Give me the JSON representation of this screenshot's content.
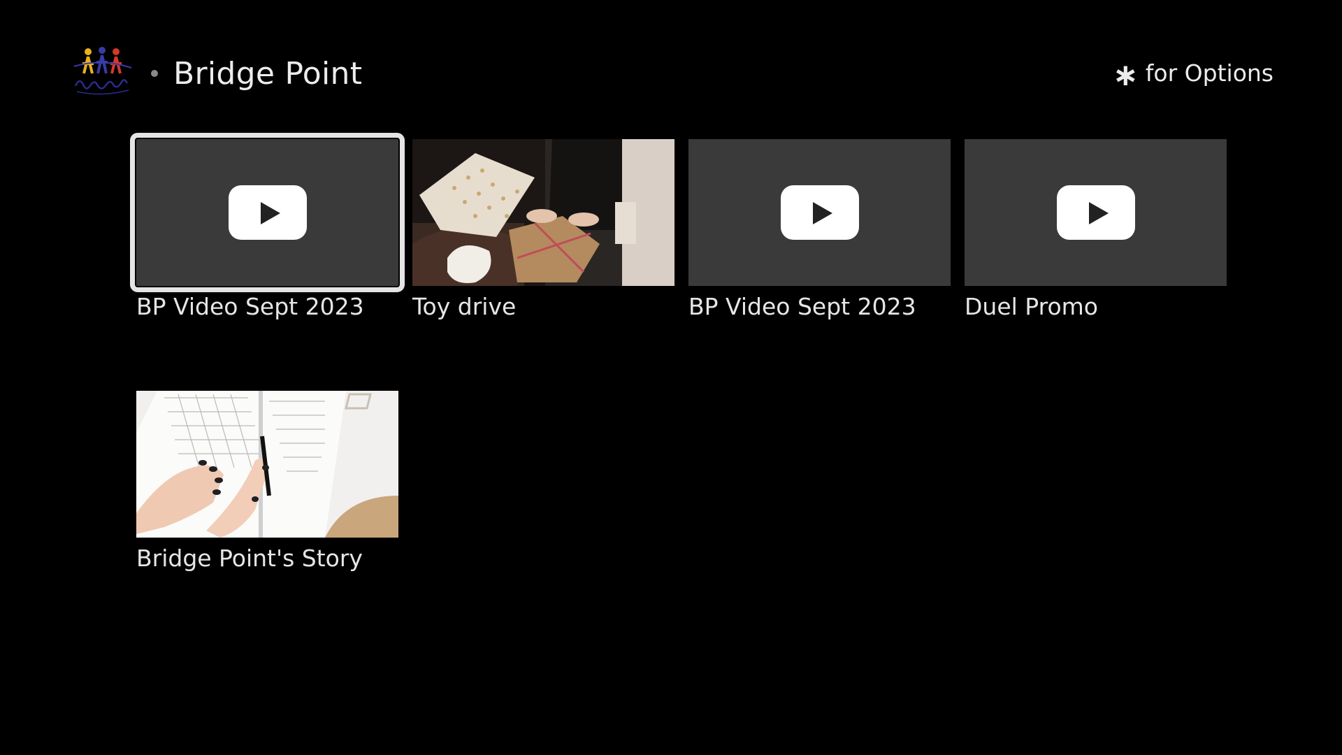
{
  "header": {
    "logo_icon": "bridge-point-people-logo",
    "channel_title": "Bridge Point",
    "options_symbol": "∗",
    "options_text": "for Options"
  },
  "tiles": [
    {
      "label": "BP Video Sept 2023",
      "thumbnail": "play-placeholder",
      "focused": true
    },
    {
      "label": "Toy drive",
      "thumbnail": "photo-gift-wrapping",
      "focused": false
    },
    {
      "label": "BP Video Sept 2023",
      "thumbnail": "play-placeholder",
      "focused": false
    },
    {
      "label": "Duel Promo",
      "thumbnail": "play-placeholder",
      "focused": false
    },
    {
      "label": "Bridge Point's Story",
      "thumbnail": "photo-writing-notebook",
      "focused": false
    }
  ],
  "colors": {
    "background": "#000000",
    "placeholder": "#3a3a3a",
    "focus_outline": "#e4e4e4",
    "text": "#e6e6e6"
  }
}
